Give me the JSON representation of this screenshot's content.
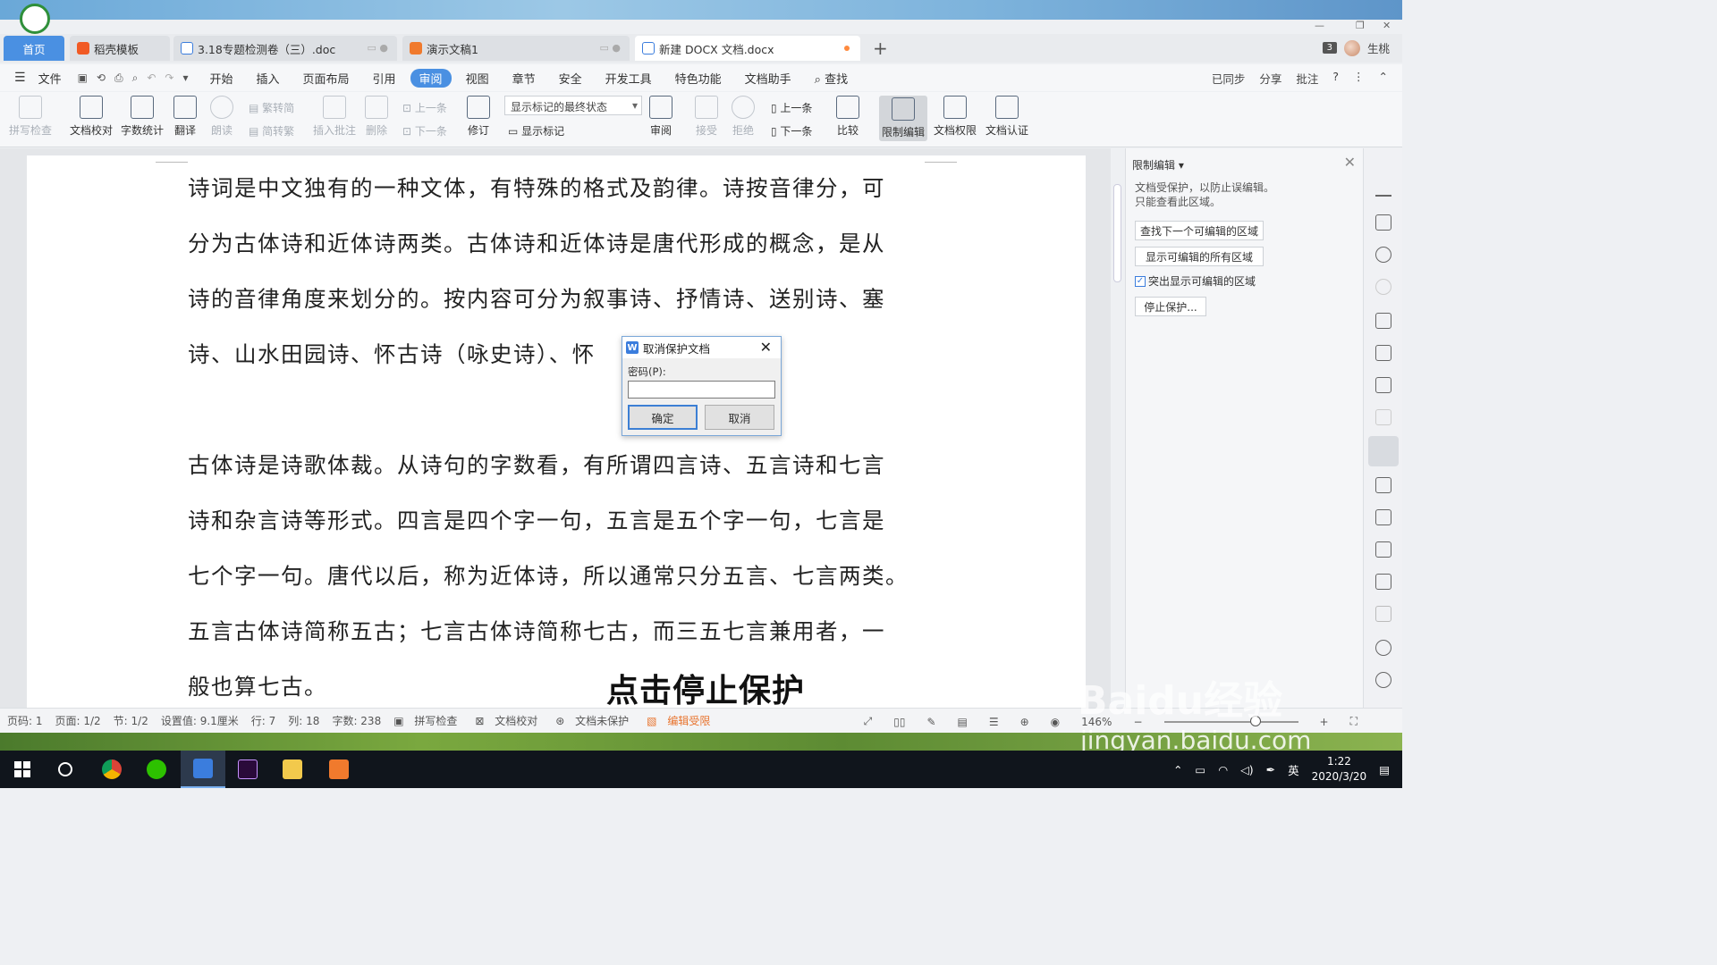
{
  "window": {
    "minimize": "—",
    "maximize": "❐",
    "close": "✕"
  },
  "tabs": [
    {
      "label": "首页"
    },
    {
      "label": "稻壳模板"
    },
    {
      "label": "3.18专题检测卷（三）.doc"
    },
    {
      "label": "演示文稿1"
    },
    {
      "label": "新建 DOCX 文档.docx"
    }
  ],
  "user": {
    "count": "3",
    "name": "生桃"
  },
  "menu": {
    "file": "文件",
    "items": [
      "开始",
      "插入",
      "页面布局",
      "引用",
      "审阅",
      "视图",
      "章节",
      "安全",
      "开发工具",
      "特色功能",
      "文档助手"
    ],
    "active": "审阅",
    "search": "查找",
    "right": [
      "已同步",
      "分享",
      "批注"
    ]
  },
  "ribbon": {
    "spellcheck": "拼写检查",
    "proofread": "文档校对",
    "wordcount": "字数统计",
    "translate": "翻译",
    "read": "朗读",
    "trad": "繁转简",
    "simp": "简转繁",
    "insert_comment": "插入批注",
    "delete": "删除",
    "prev_small": "上一条",
    "next_small": "下一条",
    "revise": "修订",
    "markup_state": "显示标记的最终状态",
    "show_markup": "显示标记",
    "review": "审阅",
    "accept": "接受",
    "reject": "拒绝",
    "prev": "上一条",
    "next": "下一条",
    "compare": "比较",
    "restrict_edit": "限制编辑",
    "doc_rights": "文档权限",
    "doc_auth": "文档认证"
  },
  "document": {
    "para1": [
      "诗词是中文独有的一种文体，有特殊的格式及韵律。诗按音律分，可",
      "分为古体诗和近体诗两类。古体诗和近体诗是唐代形成的概念，是从",
      "诗的音律角度来划分的。按内容可分为叙事诗、抒情诗、送别诗、塞",
      "诗、山水田园诗、怀古诗（咏史诗）、怀"
    ],
    "para2": [
      "古体诗是诗歌体裁。从诗句的字数看，有所谓四言诗、五言诗和七言",
      "诗和杂言诗等形式。四言是四个字一句，五言是五个字一句，七言是",
      "七个字一句。唐代以后，称为近体诗，所以通常只分五言、七言两类。",
      "五言古体诗简称五古；七言古体诗简称七古，而三五七言兼用者，一",
      "般也算七古。"
    ]
  },
  "dialog": {
    "title": "取消保护文档",
    "label": "密码(P):",
    "password_value": "",
    "ok": "确定",
    "cancel": "取消"
  },
  "panel": {
    "title": "限制编辑",
    "desc1": "文档受保护，以防止误编辑。",
    "desc2": "只能查看此区域。",
    "find_next": "查找下一个可编辑的区域",
    "show_all": "显示可编辑的所有区域",
    "highlight": "突出显示可编辑的区域",
    "highlight_checked": true,
    "stop": "停止保护..."
  },
  "status": {
    "page": "页码: 1",
    "pages": "页面: 1/2",
    "section": "节: 1/2",
    "setting": "设置值: 9.1厘米",
    "row": "行: 7",
    "col": "列: 18",
    "words": "字数: 238",
    "spell": "拼写检查",
    "proof": "文档校对",
    "unprotected": "文档未保护",
    "restricted": "编辑受限",
    "zoom": "146%"
  },
  "caption": "点击停止保护",
  "watermark": {
    "logo": "Baidu经验",
    "url": "jingyan.baidu.com"
  },
  "taskbar": {
    "ime": "英",
    "time": "1:22",
    "date": "2020/3/20"
  },
  "colors": {
    "accent": "#4a90e2",
    "warn": "#e8742e",
    "dialog_border": "#3c7fd4"
  }
}
